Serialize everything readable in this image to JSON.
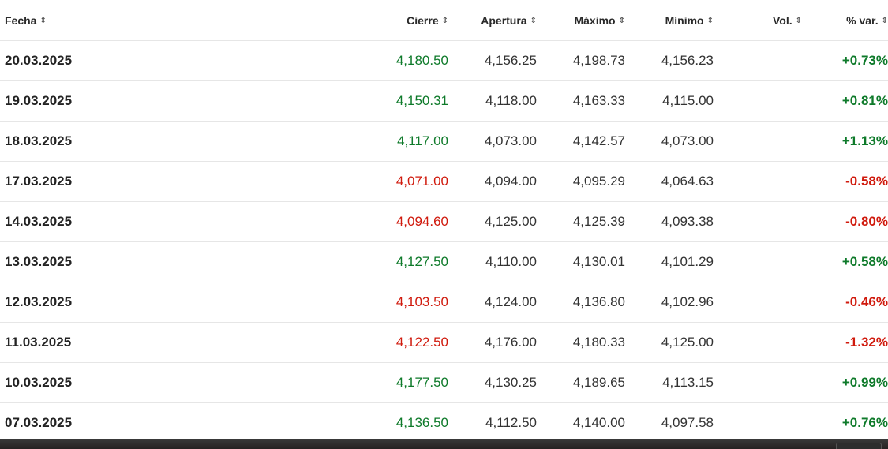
{
  "table": {
    "headers": {
      "date": "Fecha",
      "close": "Cierre",
      "open": "Apertura",
      "high": "Máximo",
      "low": "Mínimo",
      "vol": "Vol.",
      "change": "% var."
    },
    "sort_glyph": "⇕",
    "rows": [
      {
        "date": "20.03.2025",
        "close": "4,180.50",
        "open": "4,156.25",
        "high": "4,198.73",
        "low": "4,156.23",
        "vol": "",
        "change": "+0.73%",
        "dir": "pos"
      },
      {
        "date": "19.03.2025",
        "close": "4,150.31",
        "open": "4,118.00",
        "high": "4,163.33",
        "low": "4,115.00",
        "vol": "",
        "change": "+0.81%",
        "dir": "pos"
      },
      {
        "date": "18.03.2025",
        "close": "4,117.00",
        "open": "4,073.00",
        "high": "4,142.57",
        "low": "4,073.00",
        "vol": "",
        "change": "+1.13%",
        "dir": "pos"
      },
      {
        "date": "17.03.2025",
        "close": "4,071.00",
        "open": "4,094.00",
        "high": "4,095.29",
        "low": "4,064.63",
        "vol": "",
        "change": "-0.58%",
        "dir": "neg"
      },
      {
        "date": "14.03.2025",
        "close": "4,094.60",
        "open": "4,125.00",
        "high": "4,125.39",
        "low": "4,093.38",
        "vol": "",
        "change": "-0.80%",
        "dir": "neg"
      },
      {
        "date": "13.03.2025",
        "close": "4,127.50",
        "open": "4,110.00",
        "high": "4,130.01",
        "low": "4,101.29",
        "vol": "",
        "change": "+0.58%",
        "dir": "pos"
      },
      {
        "date": "12.03.2025",
        "close": "4,103.50",
        "open": "4,124.00",
        "high": "4,136.80",
        "low": "4,102.96",
        "vol": "",
        "change": "-0.46%",
        "dir": "neg"
      },
      {
        "date": "11.03.2025",
        "close": "4,122.50",
        "open": "4,176.00",
        "high": "4,180.33",
        "low": "4,125.00",
        "vol": "",
        "change": "-1.32%",
        "dir": "neg"
      },
      {
        "date": "10.03.2025",
        "close": "4,177.50",
        "open": "4,130.25",
        "high": "4,189.65",
        "low": "4,113.15",
        "vol": "",
        "change": "+0.99%",
        "dir": "pos"
      },
      {
        "date": "07.03.2025",
        "close": "4,136.50",
        "open": "4,112.50",
        "high": "4,140.00",
        "low": "4,097.58",
        "vol": "",
        "change": "+0.76%",
        "dir": "pos"
      }
    ]
  },
  "colors": {
    "positive": "#0e7a2a",
    "negative": "#d01a0d"
  }
}
